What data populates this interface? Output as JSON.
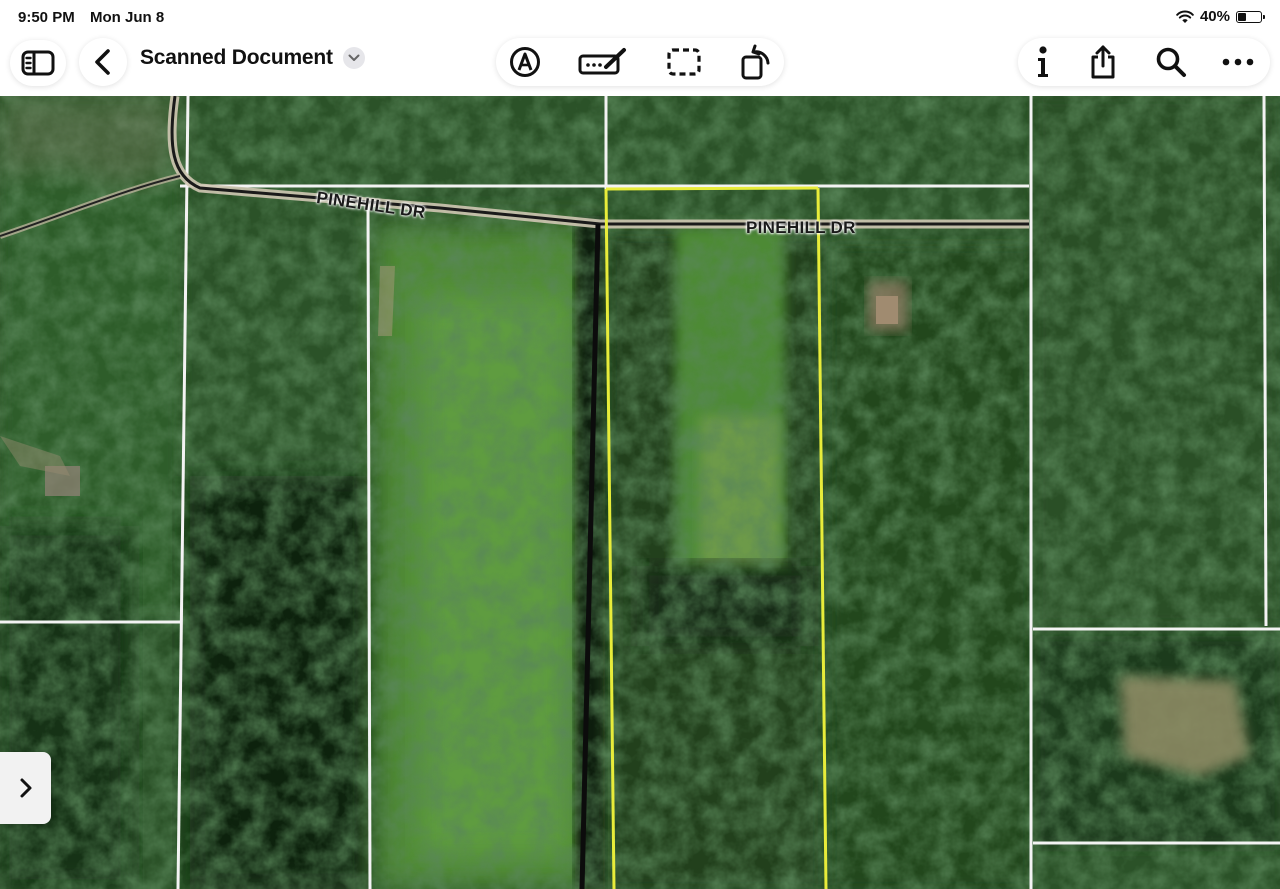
{
  "status_bar": {
    "time": "9:50 PM",
    "date": "Mon Jun 8",
    "battery_text": "40%",
    "battery_level": 0.4
  },
  "toolbar": {
    "title": "Scanned Document",
    "icons": {
      "sidebar": "sidebar-toggle-icon",
      "back": "chevron-left-icon",
      "title_menu": "chevron-down-icon",
      "markup": "pen-tip-circle-icon",
      "form_fill": "signature-pen-icon",
      "selection": "dashed-rectangle-icon",
      "rotate": "rotate-page-icon",
      "info": "info-icon",
      "share": "share-icon",
      "search": "search-icon",
      "more": "ellipsis-icon"
    }
  },
  "document": {
    "road_labels": [
      "PINEHILL DR",
      "PINEHILL DR"
    ],
    "colors": {
      "parcel_highlight": "#e8ec3a",
      "parcel_lines": "#f4f4f4",
      "forest_dark": "#1f3a1c",
      "forest_mid": "#2e5a2a",
      "clearing": "#6b8f3e"
    }
  },
  "edge_tab": {
    "icon": "chevron-right-icon"
  }
}
